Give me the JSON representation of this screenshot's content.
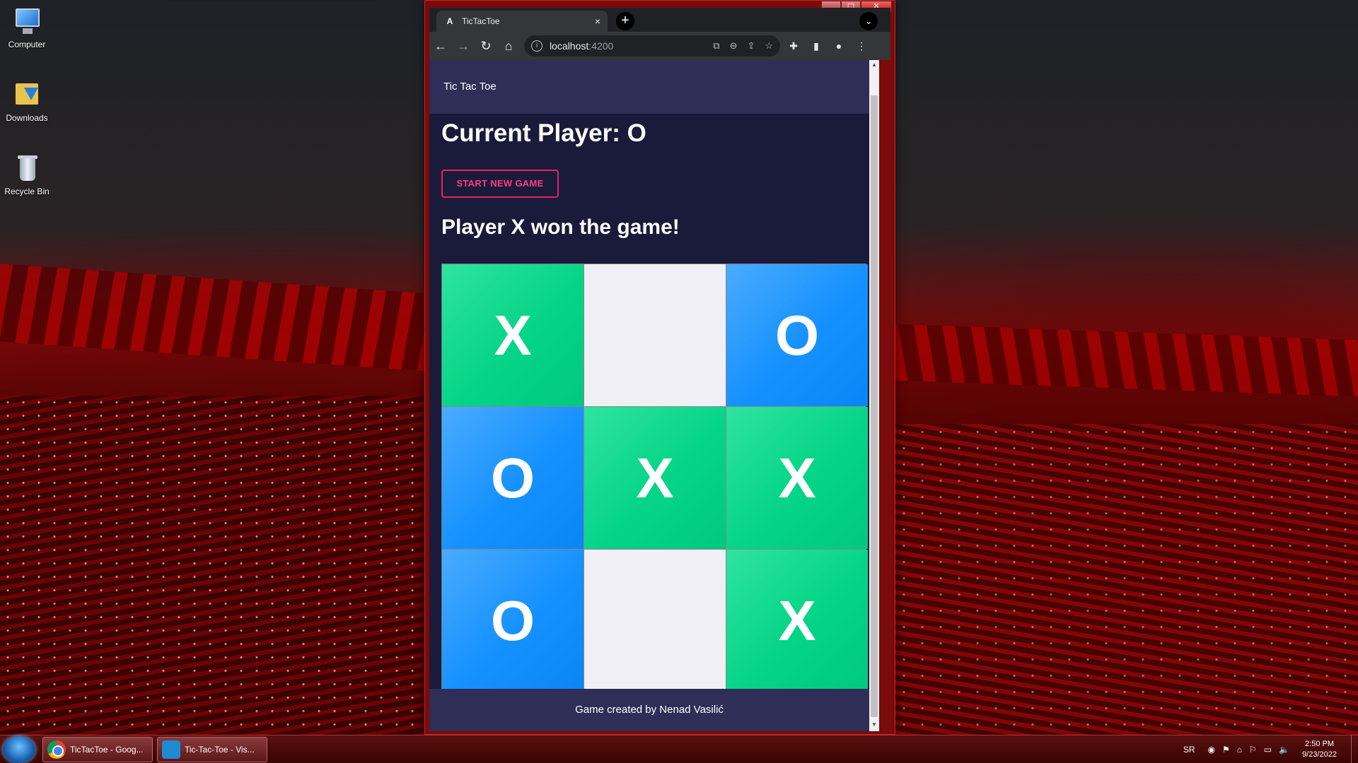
{
  "desktop": {
    "icons": [
      {
        "label": "Computer"
      },
      {
        "label": "Downloads"
      },
      {
        "label": "Recycle Bin"
      }
    ]
  },
  "browser": {
    "tab_title": "TicTacToe",
    "tab_favicon": "A",
    "tab_close": "×",
    "new_tab": "+",
    "tab_search": "⌄",
    "url_host": "localhost",
    "url_port": ":4200",
    "window_controls": {
      "minimize": "▁",
      "maximize": "▢",
      "close": "✕"
    }
  },
  "app": {
    "header_title": "Tic Tac Toe",
    "current_player_label": "Current Player: O",
    "new_game_button": "START NEW GAME",
    "winner_message": "Player X won the game!",
    "board": [
      "X",
      "",
      "O",
      "O",
      "X",
      "X",
      "O",
      "",
      "X"
    ],
    "footer": "Game created by Nenad Vasilić"
  },
  "colors": {
    "x_cell": "#05d487",
    "o_cell": "#1591ff",
    "empty_cell": "#f0eff6",
    "accent": "#e8226a",
    "page_bg": "#1a1a3a",
    "header_bg": "#2e2e56"
  },
  "taskbar": {
    "items": [
      {
        "label": "TicTacToe - Goog..."
      },
      {
        "label": "Tic-Tac-Toe - Vis..."
      }
    ],
    "language": "SR",
    "time": "2:50 PM",
    "date": "9/23/2022"
  }
}
